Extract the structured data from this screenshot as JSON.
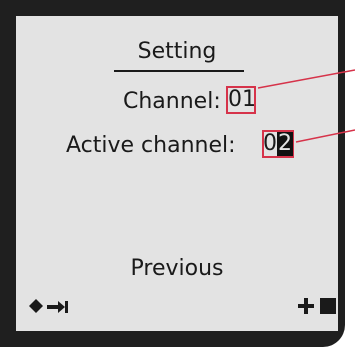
{
  "screen": {
    "title": "Setting",
    "channel_label": "Channel:",
    "channel_value": "01",
    "active_label": "Active channel:",
    "active_value_prefix": "0",
    "active_value_cursor": "2",
    "previous_label": "Previous"
  },
  "softkeys": {
    "left_icons": [
      "diamond-icon",
      "arrow-right-to-bar-icon"
    ],
    "right_icons": [
      "plus-icon",
      "square-icon"
    ]
  },
  "colors": {
    "bezel": "#1f1f1f",
    "screen": "#e3e3e3",
    "text": "#1a1a1a",
    "highlight": "#d6334a"
  }
}
